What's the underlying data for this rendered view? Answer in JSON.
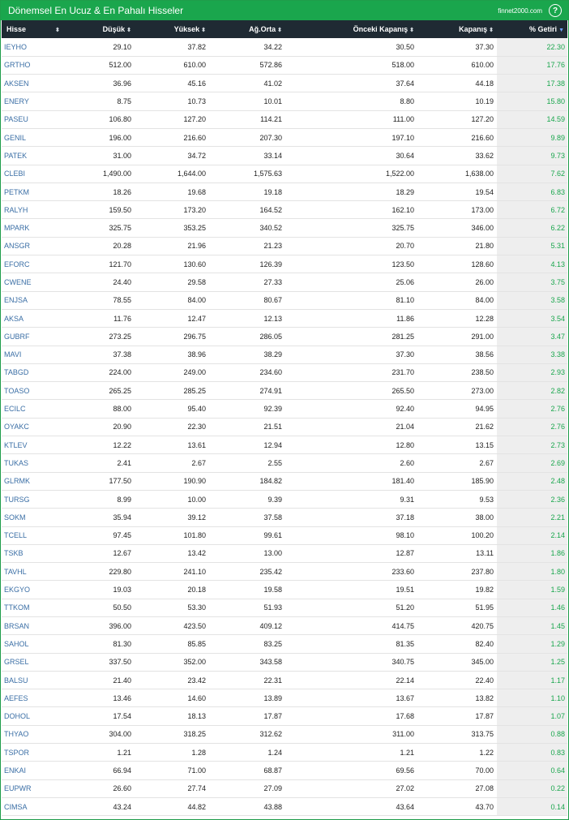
{
  "header": {
    "title": "Dönemsel En Ucuz & En Pahalı Hisseler",
    "brand": "finnet2000.com",
    "help_label": "?"
  },
  "table": {
    "columns": [
      "Hisse",
      "Düşük",
      "Yüksek",
      "Ağ.Orta",
      "Önceki Kapanış",
      "Kapanış",
      "% Getiri"
    ],
    "sort_active_column": "% Getiri",
    "rows": [
      [
        "IEYHO",
        "29.10",
        "37.82",
        "34.22",
        "30.50",
        "37.30",
        "22.30"
      ],
      [
        "GRTHO",
        "512.00",
        "610.00",
        "572.86",
        "518.00",
        "610.00",
        "17.76"
      ],
      [
        "AKSEN",
        "36.96",
        "45.16",
        "41.02",
        "37.64",
        "44.18",
        "17.38"
      ],
      [
        "ENERY",
        "8.75",
        "10.73",
        "10.01",
        "8.80",
        "10.19",
        "15.80"
      ],
      [
        "PASEU",
        "106.80",
        "127.20",
        "114.21",
        "111.00",
        "127.20",
        "14.59"
      ],
      [
        "GENIL",
        "196.00",
        "216.60",
        "207.30",
        "197.10",
        "216.60",
        "9.89"
      ],
      [
        "PATEK",
        "31.00",
        "34.72",
        "33.14",
        "30.64",
        "33.62",
        "9.73"
      ],
      [
        "CLEBI",
        "1,490.00",
        "1,644.00",
        "1,575.63",
        "1,522.00",
        "1,638.00",
        "7.62"
      ],
      [
        "PETKM",
        "18.26",
        "19.68",
        "19.18",
        "18.29",
        "19.54",
        "6.83"
      ],
      [
        "RALYH",
        "159.50",
        "173.20",
        "164.52",
        "162.10",
        "173.00",
        "6.72"
      ],
      [
        "MPARK",
        "325.75",
        "353.25",
        "340.52",
        "325.75",
        "346.00",
        "6.22"
      ],
      [
        "ANSGR",
        "20.28",
        "21.96",
        "21.23",
        "20.70",
        "21.80",
        "5.31"
      ],
      [
        "EFORC",
        "121.70",
        "130.60",
        "126.39",
        "123.50",
        "128.60",
        "4.13"
      ],
      [
        "CWENE",
        "24.40",
        "29.58",
        "27.33",
        "25.06",
        "26.00",
        "3.75"
      ],
      [
        "ENJSA",
        "78.55",
        "84.00",
        "80.67",
        "81.10",
        "84.00",
        "3.58"
      ],
      [
        "AKSA",
        "11.76",
        "12.47",
        "12.13",
        "11.86",
        "12.28",
        "3.54"
      ],
      [
        "GUBRF",
        "273.25",
        "296.75",
        "286.05",
        "281.25",
        "291.00",
        "3.47"
      ],
      [
        "MAVI",
        "37.38",
        "38.96",
        "38.29",
        "37.30",
        "38.56",
        "3.38"
      ],
      [
        "TABGD",
        "224.00",
        "249.00",
        "234.60",
        "231.70",
        "238.50",
        "2.93"
      ],
      [
        "TOASO",
        "265.25",
        "285.25",
        "274.91",
        "265.50",
        "273.00",
        "2.82"
      ],
      [
        "ECILC",
        "88.00",
        "95.40",
        "92.39",
        "92.40",
        "94.95",
        "2.76"
      ],
      [
        "OYAKC",
        "20.90",
        "22.30",
        "21.51",
        "21.04",
        "21.62",
        "2.76"
      ],
      [
        "KTLEV",
        "12.22",
        "13.61",
        "12.94",
        "12.80",
        "13.15",
        "2.73"
      ],
      [
        "TUKAS",
        "2.41",
        "2.67",
        "2.55",
        "2.60",
        "2.67",
        "2.69"
      ],
      [
        "GLRMK",
        "177.50",
        "190.90",
        "184.82",
        "181.40",
        "185.90",
        "2.48"
      ],
      [
        "TURSG",
        "8.99",
        "10.00",
        "9.39",
        "9.31",
        "9.53",
        "2.36"
      ],
      [
        "SOKM",
        "35.94",
        "39.12",
        "37.58",
        "37.18",
        "38.00",
        "2.21"
      ],
      [
        "TCELL",
        "97.45",
        "101.80",
        "99.61",
        "98.10",
        "100.20",
        "2.14"
      ],
      [
        "TSKB",
        "12.67",
        "13.42",
        "13.00",
        "12.87",
        "13.11",
        "1.86"
      ],
      [
        "TAVHL",
        "229.80",
        "241.10",
        "235.42",
        "233.60",
        "237.80",
        "1.80"
      ],
      [
        "EKGYO",
        "19.03",
        "20.18",
        "19.58",
        "19.51",
        "19.82",
        "1.59"
      ],
      [
        "TTKOM",
        "50.50",
        "53.30",
        "51.93",
        "51.20",
        "51.95",
        "1.46"
      ],
      [
        "BRSAN",
        "396.00",
        "423.50",
        "409.12",
        "414.75",
        "420.75",
        "1.45"
      ],
      [
        "SAHOL",
        "81.30",
        "85.85",
        "83.25",
        "81.35",
        "82.40",
        "1.29"
      ],
      [
        "GRSEL",
        "337.50",
        "352.00",
        "343.58",
        "340.75",
        "345.00",
        "1.25"
      ],
      [
        "BALSU",
        "21.40",
        "23.42",
        "22.31",
        "22.14",
        "22.40",
        "1.17"
      ],
      [
        "AEFES",
        "13.46",
        "14.60",
        "13.89",
        "13.67",
        "13.82",
        "1.10"
      ],
      [
        "DOHOL",
        "17.54",
        "18.13",
        "17.87",
        "17.68",
        "17.87",
        "1.07"
      ],
      [
        "THYAO",
        "304.00",
        "318.25",
        "312.62",
        "311.00",
        "313.75",
        "0.88"
      ],
      [
        "TSPOR",
        "1.21",
        "1.28",
        "1.24",
        "1.21",
        "1.22",
        "0.83"
      ],
      [
        "ENKAI",
        "66.94",
        "71.00",
        "68.87",
        "69.56",
        "70.00",
        "0.64"
      ],
      [
        "EUPWR",
        "26.60",
        "27.74",
        "27.09",
        "27.02",
        "27.08",
        "0.22"
      ],
      [
        "CIMSA",
        "43.24",
        "44.82",
        "43.88",
        "43.64",
        "43.70",
        "0.14"
      ]
    ]
  },
  "colors": {
    "header_green": "#1aa64d",
    "header_dark": "#1f2a33",
    "symbol_blue": "#3a6ea5",
    "gain_green": "#1aa64d"
  }
}
